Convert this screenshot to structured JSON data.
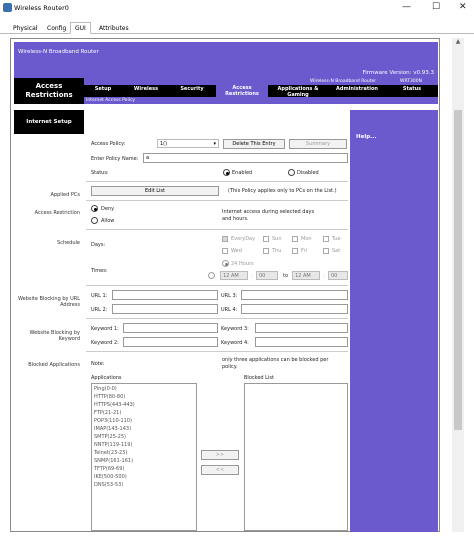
{
  "window": {
    "title": "Wireless Router0"
  },
  "tabs": [
    "Physical",
    "Config",
    "GUI",
    "Attributes"
  ],
  "banner": {
    "brand": "Wireless-N Broadband Router",
    "firmware": "Firmware Version: v0.93.3"
  },
  "nav": {
    "section_title": "Access Restrictions",
    "model_name": "Wireless-N Broadband Router",
    "model_number": "WRT300N",
    "items": [
      "Setup",
      "Wireless",
      "Security",
      "Access Restrictions",
      "Applications & Gaming",
      "Administration",
      "Status"
    ],
    "subnav": "Internet Access Policy"
  },
  "left": {
    "section": "Internet Setup",
    "applied_pcs": "Applied PCs",
    "access_restriction": "Access Restriction",
    "schedule": "Schedule",
    "website_url": "Website Blocking by URL Address",
    "website_kw": "Website Blocking by Keyword",
    "blocked_apps": "Blocked Applications"
  },
  "help": "Help...",
  "form": {
    "access_policy_label": "Access Policy:",
    "access_policy_value": "1()",
    "delete_btn": "Delete This Entry",
    "summary_btn": "Summary",
    "policy_name_label": "Enter Policy Name:",
    "policy_name_value": "a",
    "status_label": "Status:",
    "enabled": "Enabled",
    "disabled": "Disabled",
    "edit_list": "Edit List",
    "edit_list_note": "(This Policy applies only to PCs on the List.)",
    "deny": "Deny",
    "allow": "Allow",
    "access_note": "Internet access during selected days and hours.",
    "days_label": "Days:",
    "days": [
      "EveryDay",
      "Sun",
      "Mon",
      "Tue",
      "Wed",
      "Thu",
      "Fri",
      "Sat"
    ],
    "times_label": "Times:",
    "hours24": "24 Hours",
    "from_hour": "12 AM",
    "from_min": "00",
    "to_label": "to",
    "to_hour": "12 AM",
    "to_min": "00",
    "url_labels": [
      "URL 1:",
      "URL 2:",
      "URL 3:",
      "URL 4:"
    ],
    "kw_labels": [
      "Keyword 1:",
      "Keyword 2:",
      "Keyword 3:",
      "Keyword 4:"
    ],
    "note_label": "Note:",
    "note_text": "only three applications can be blocked per policy.",
    "applications_label": "Applications",
    "blocked_list_label": "Blocked List",
    "applications": [
      "Ping(0-0)",
      "HTTP(80-80)",
      "HTTPS(443-443)",
      "FTP(21-21)",
      "POP3(110-110)",
      "IMAP(143-143)",
      "SMTP(25-25)",
      "NNTP(119-119)",
      "Telnet(23-23)",
      "SNMP(161-161)",
      "TFTP(69-69)",
      "IKE(500-500)",
      "DNS(53-53)"
    ],
    "add_btn": ">>",
    "remove_btn": "<<"
  }
}
